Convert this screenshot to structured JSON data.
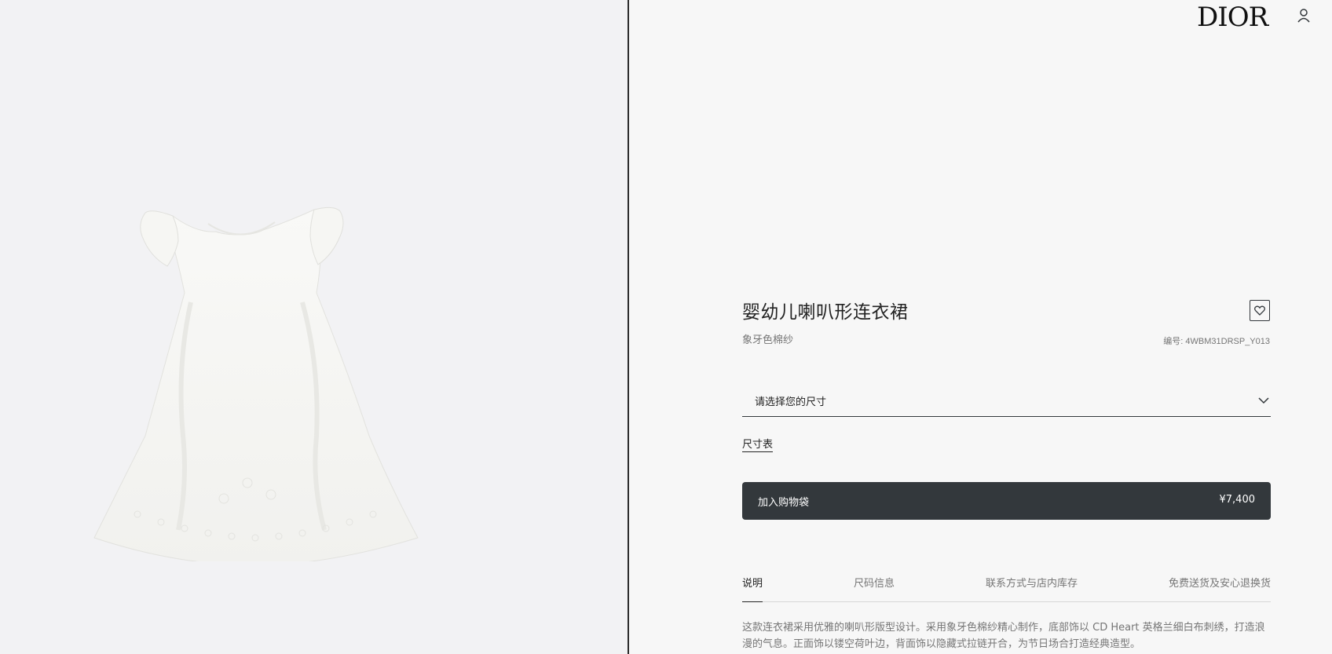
{
  "header": {
    "logo": "DIOR",
    "icons": [
      "user-icon",
      "dior-logo"
    ]
  },
  "gallery": {
    "image": "white-dress-image"
  },
  "product": {
    "title": "婴幼儿喇叭形连衣裙",
    "subtitle": "象牙色棉纱",
    "ref": "编号: 4WBM31DRSP_Y013",
    "wishlist_icon": "heart-icon"
  },
  "size_select": {
    "label": "请选择您的尺寸",
    "icon": "chevron-down-icon"
  },
  "size_guide": "尺寸表",
  "add_to_bag": {
    "label": "加入购物袋",
    "price": "¥7,400"
  },
  "tabs": [
    {
      "label": "说明",
      "active": true
    },
    {
      "label": "尺码信息",
      "active": false
    },
    {
      "label": "联系方式与店内库存",
      "active": false
    },
    {
      "label": "免费送货及安心退换货",
      "active": false
    }
  ],
  "description": "这款连衣裙采用优雅的喇叭形版型设计。采用象牙色棉纱精心制作，底部饰以 CD Heart 英格兰细白布刺绣，打造浪漫的气息。正面饰以镂空荷叶边，背面饰以隐藏式拉链开合，为节日场合打造经典造型。",
  "colors": {
    "button_bg": "#33383c",
    "page_bg": "#f7f7f7",
    "gallery_bg": "#f2f2f4"
  }
}
